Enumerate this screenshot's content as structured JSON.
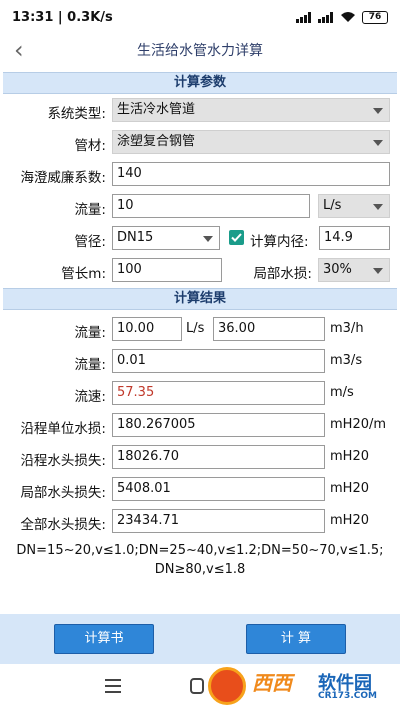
{
  "status_bar": {
    "time": "13:31 | 0.3K/s",
    "battery": "76"
  },
  "header": {
    "title": "生活给水管水力详算"
  },
  "params": {
    "section_title": "计算参数",
    "system_type_label": "系统类型:",
    "system_type_value": "生活冷水管道",
    "material_label": "管材:",
    "material_value": "涂塑复合钢管",
    "hazen_label": "海澄威廉系数:",
    "hazen_value": "140",
    "flow_label": "流量:",
    "flow_value": "10",
    "flow_unit": "L/s",
    "diameter_label": "管径:",
    "diameter_value": "DN15",
    "calc_inner_label": "计算内径:",
    "calc_inner_value": "14.9",
    "length_label": "管长m:",
    "length_value": "100",
    "local_loss_label": "局部水损:",
    "local_loss_value": "30%"
  },
  "results": {
    "section_title": "计算结果",
    "flow1_label": "流量:",
    "flow1_value_a": "10.00",
    "flow1_unit_a": "L/s",
    "flow1_value_b": "36.00",
    "flow1_unit_b": "m3/h",
    "flow2_label": "流量:",
    "flow2_value": "0.01",
    "flow2_unit": "m3/s",
    "velocity_label": "流速:",
    "velocity_value": "57.35",
    "velocity_unit": "m/s",
    "unit_loss_label": "沿程单位水损:",
    "unit_loss_value": "180.267005",
    "unit_loss_unit": "mH20/m",
    "head_loss_label": "沿程水头损失:",
    "head_loss_value": "18026.70",
    "head_loss_unit": "mH20",
    "local_head_label": "局部水头损失:",
    "local_head_value": "5408.01",
    "local_head_unit": "mH20",
    "total_head_label": "全部水头损失:",
    "total_head_value": "23434.71",
    "total_head_unit": "mH20"
  },
  "note": {
    "line1": "DN=15~20,v≤1.0;DN=25~40,v≤1.2;DN=50~70,v≤1.5;",
    "line2": "DN≥80,v≤1.8"
  },
  "buttons": {
    "report": "计算书",
    "calculate": "计  算"
  },
  "watermark": {
    "text1": "西西",
    "text2": "软件园",
    "url": "CR173.COM"
  },
  "colors": {
    "section_bg": "#d6e6f8",
    "button": "#2f86d8",
    "checkbox": "#1a9c8a",
    "velocity_warn": "#c0392b"
  }
}
